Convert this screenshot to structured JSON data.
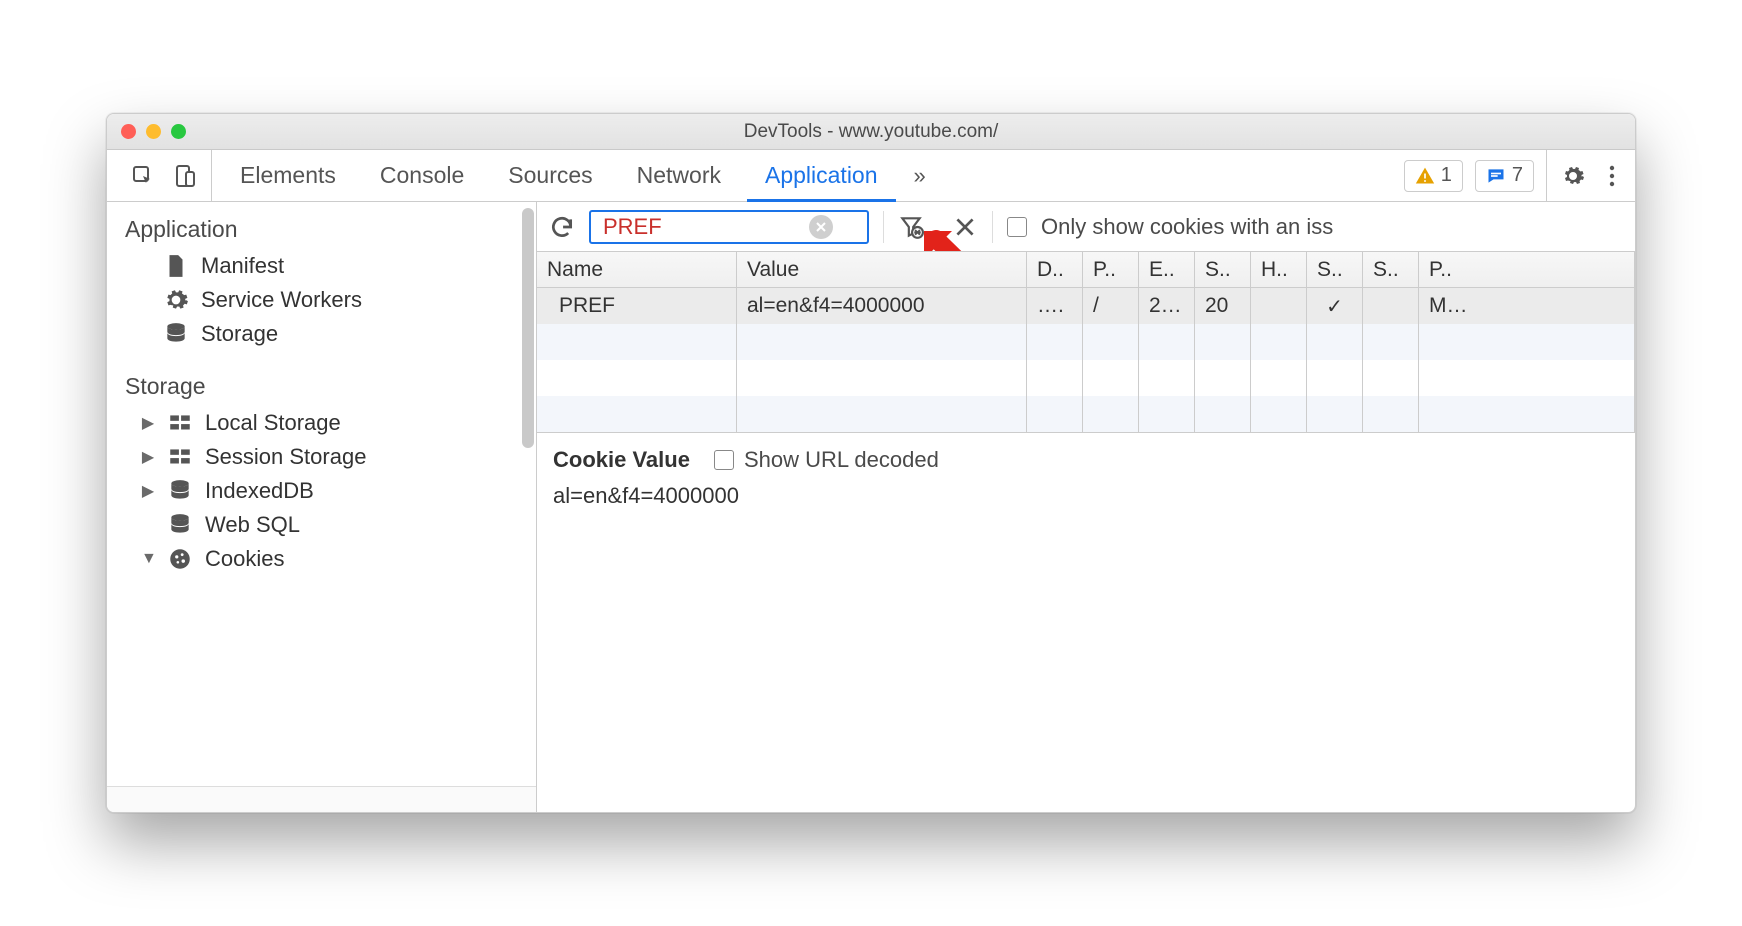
{
  "window": {
    "title": "DevTools - www.youtube.com/"
  },
  "tabs": {
    "items": [
      "Elements",
      "Console",
      "Sources",
      "Network",
      "Application"
    ],
    "more": "»",
    "active_index": 4
  },
  "badges": {
    "warnings": "1",
    "messages": "7"
  },
  "sidebar": {
    "sections": [
      {
        "title": "Application",
        "items": [
          {
            "label": "Manifest",
            "icon": "file-icon"
          },
          {
            "label": "Service Workers",
            "icon": "gear-icon"
          },
          {
            "label": "Storage",
            "icon": "database-icon"
          }
        ]
      },
      {
        "title": "Storage",
        "items": [
          {
            "label": "Local Storage",
            "icon": "grid-icon",
            "expandable": true,
            "expanded": false
          },
          {
            "label": "Session Storage",
            "icon": "grid-icon",
            "expandable": true,
            "expanded": false
          },
          {
            "label": "IndexedDB",
            "icon": "database-icon",
            "expandable": true,
            "expanded": false
          },
          {
            "label": "Web SQL",
            "icon": "database-icon",
            "expandable": false
          },
          {
            "label": "Cookies",
            "icon": "cookie-icon",
            "expandable": true,
            "expanded": true
          }
        ]
      }
    ]
  },
  "toolbar": {
    "filter_value": "PREF",
    "only_issues_label": "Only show cookies with an iss"
  },
  "table": {
    "headers": [
      "Name",
      "Value",
      "D..",
      "P..",
      "E..",
      "S..",
      "H..",
      "S..",
      "S..",
      "P.."
    ],
    "rows": [
      {
        "name": "PREF",
        "value": "al=en&f4=4000000",
        "d": "….",
        "p": "/",
        "e": "2…",
        "si": "20",
        "h": "",
        "se": "✓",
        "ss": "",
        "pr": "M…"
      }
    ]
  },
  "cookie_value": {
    "heading": "Cookie Value",
    "show_decoded": "Show URL decoded",
    "value": "al=en&f4=4000000"
  }
}
